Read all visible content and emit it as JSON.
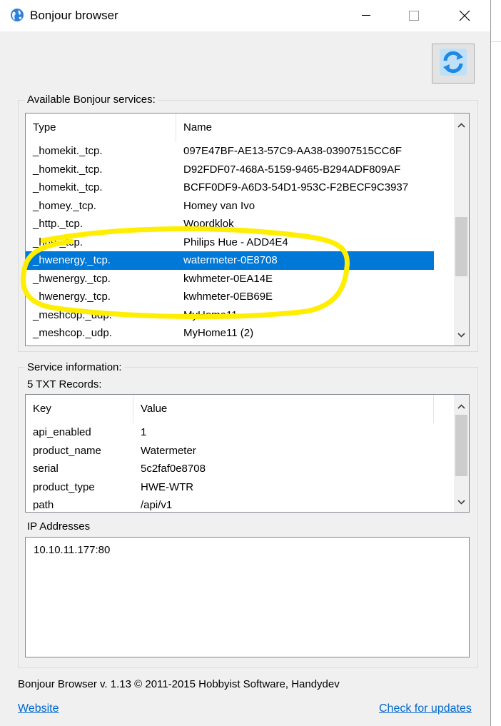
{
  "window": {
    "title": "Bonjour browser"
  },
  "titlebar_buttons": {
    "minimize": "—",
    "maximize": "☐",
    "close": "✕"
  },
  "services_group": {
    "label": "Available Bonjour services:",
    "columns": [
      "Type",
      "Name"
    ],
    "rows": [
      {
        "type": "_homekit._tcp.",
        "name": "097E47BF-AE13-57C9-AA38-03907515CC6F"
      },
      {
        "type": "_homekit._tcp.",
        "name": "D92FDF07-468A-5159-9465-B294ADF809AF"
      },
      {
        "type": "_homekit._tcp.",
        "name": "BCFF0DF9-A6D3-54D1-953C-F2BECF9C3937"
      },
      {
        "type": "_homey._tcp.",
        "name": "Homey van Ivo"
      },
      {
        "type": "_http._tcp.",
        "name": "Woordklok"
      },
      {
        "type": "_hue._tcp.",
        "name": "Philips Hue - ADD4E4"
      },
      {
        "type": "_hwenergy._tcp.",
        "name": "watermeter-0E8708",
        "selected": true
      },
      {
        "type": "_hwenergy._tcp.",
        "name": "kwhmeter-0EA14E"
      },
      {
        "type": "_hwenergy._tcp.",
        "name": "kwhmeter-0EB69E"
      },
      {
        "type": "_meshcop._udp.",
        "name": "MyHome11"
      },
      {
        "type": "_meshcop._udp.",
        "name": "MyHome11 (2)"
      }
    ]
  },
  "service_info": {
    "label": "Service information:",
    "txt_count_label": "5 TXT Records:",
    "columns": [
      "Key",
      "Value"
    ],
    "records": [
      {
        "key": "api_enabled",
        "value": "1"
      },
      {
        "key": "product_name",
        "value": "Watermeter"
      },
      {
        "key": "serial",
        "value": "5c2faf0e8708"
      },
      {
        "key": "product_type",
        "value": "HWE-WTR"
      },
      {
        "key": "path",
        "value": "/api/v1"
      }
    ],
    "ip_label": "IP Addresses",
    "ip_addresses": "10.10.11.177:80"
  },
  "footer": {
    "version_text": "Bonjour Browser v. 1.13 © 2011-2015 Hobbyist Software, Handydev",
    "website_link": "Website",
    "updates_link": "Check for updates"
  },
  "colors": {
    "selection": "#0078d7",
    "annotation": "#ffee00",
    "link": "#0066cc"
  },
  "icons": {
    "app": "globe-icon",
    "refresh": "refresh-icon"
  }
}
